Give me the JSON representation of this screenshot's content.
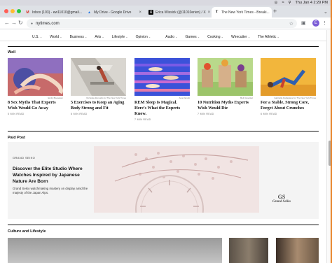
{
  "menubar": {
    "datetime": "Thu Jan 4 2:29 PM"
  },
  "tabs": [
    {
      "title": "Inbox (103) - ew11010@gmail...",
      "icon": "gmail-icon",
      "active": false
    },
    {
      "title": "My Drive - Google Drive",
      "icon": "google-drive-icon",
      "active": false
    },
    {
      "title": "Erica Wissick (@11010erien) / X",
      "icon": "x-icon",
      "active": false
    },
    {
      "title": "The New York Times - Breaki...",
      "icon": "nyt-icon",
      "active": true
    }
  ],
  "address": {
    "url": "nytimes.com",
    "profile_initial": "E"
  },
  "site_nav": [
    "U.S.",
    "World",
    "Business",
    "Arts",
    "Lifestyle",
    "Opinion",
    "Audio",
    "Games",
    "Cooking",
    "Wirecutter",
    "The Athletic"
  ],
  "well": {
    "label": "Well",
    "cards": [
      {
        "headline": "8 Sex Myths That Experts Wish Would Go Away",
        "readtime": "5 MIN READ",
        "credit": "Emily Boeseken"
      },
      {
        "headline": "5 Exercises to Keep an Aging Body Strong and Fit",
        "readtime": "6 MIN READ",
        "credit": "Nicholas Zamudio for The New York Times"
      },
      {
        "headline": "REM Sleep Is Magical. Here's What the Experts Know.",
        "readtime": "7 MIN READ",
        "credit": "Ana Zanotti"
      },
      {
        "headline": "10 Nutrition Myths Experts Wish Would Die",
        "readtime": "7 MIN READ",
        "credit": "Beth Hoeckel"
      },
      {
        "headline": "For a Stable, Strong Core, Forget About Crunches",
        "readtime": "6 MIN READ",
        "credit": "Gabriella Dellapiane for The New York Times"
      }
    ]
  },
  "paid_post": {
    "label": "Paid Post",
    "brand": "GRAND SEIKO",
    "title": "Discover the Elite Studio Where Watches Inspired by Japanese Nature Are Born",
    "description": "Grand Seiko watchmaking mastery on display amid the majesty of the Japan Alps.",
    "logo_mark": "GS",
    "logo_name": "Grand Seiko"
  },
  "culture": {
    "label": "Culture and Lifestyle"
  },
  "colors": {
    "nyt_rule": "#121212",
    "paid_bg": "#f4f4f4",
    "accent_edge": "#e8842a"
  }
}
